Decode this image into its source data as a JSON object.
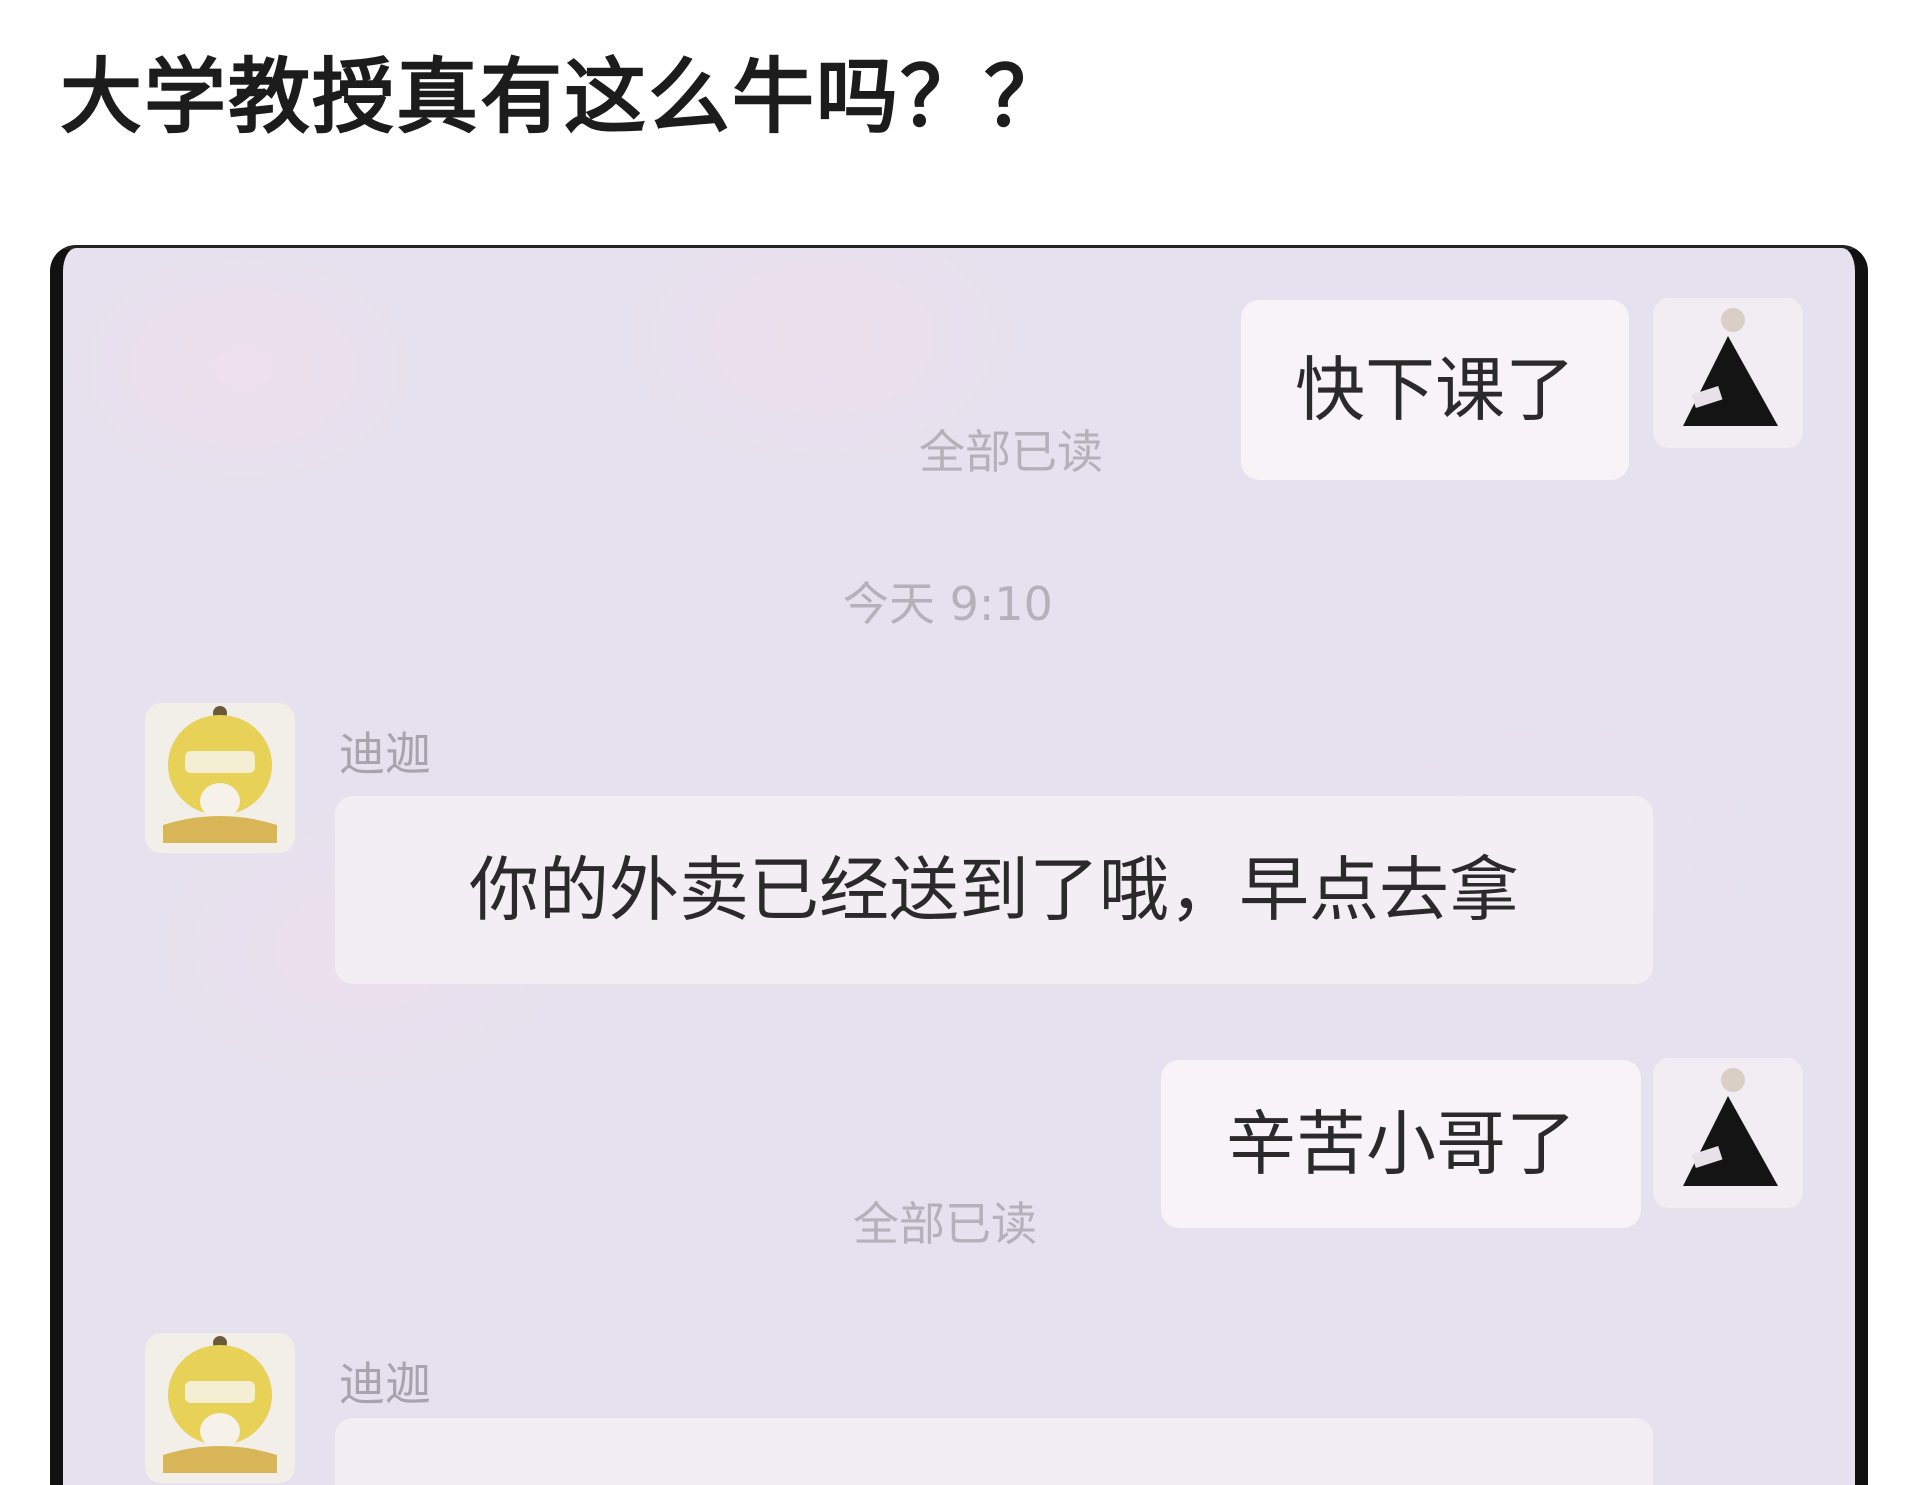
{
  "post": {
    "title": "大学教授真有这么牛吗？？"
  },
  "chat": {
    "messages": [
      {
        "direction": "outgoing",
        "text": "快下课了",
        "read_status": "全部已读"
      },
      {
        "direction": "timestamp",
        "text": "今天 9:10"
      },
      {
        "direction": "incoming",
        "sender": "迪迦",
        "text": "你的外卖已经送到了哦，早点去拿"
      },
      {
        "direction": "outgoing",
        "text": "辛苦小哥了",
        "read_status": "全部已读"
      },
      {
        "direction": "incoming",
        "sender": "迪迦",
        "text": ""
      }
    ],
    "avatars": {
      "self": "dark-mountain-avatar-icon",
      "peer": "yellow-cartoon-avatar-icon"
    }
  },
  "colors": {
    "chat_background": "#e6e1ee",
    "bubble": "#f7f3f7",
    "frame": "#111111"
  }
}
